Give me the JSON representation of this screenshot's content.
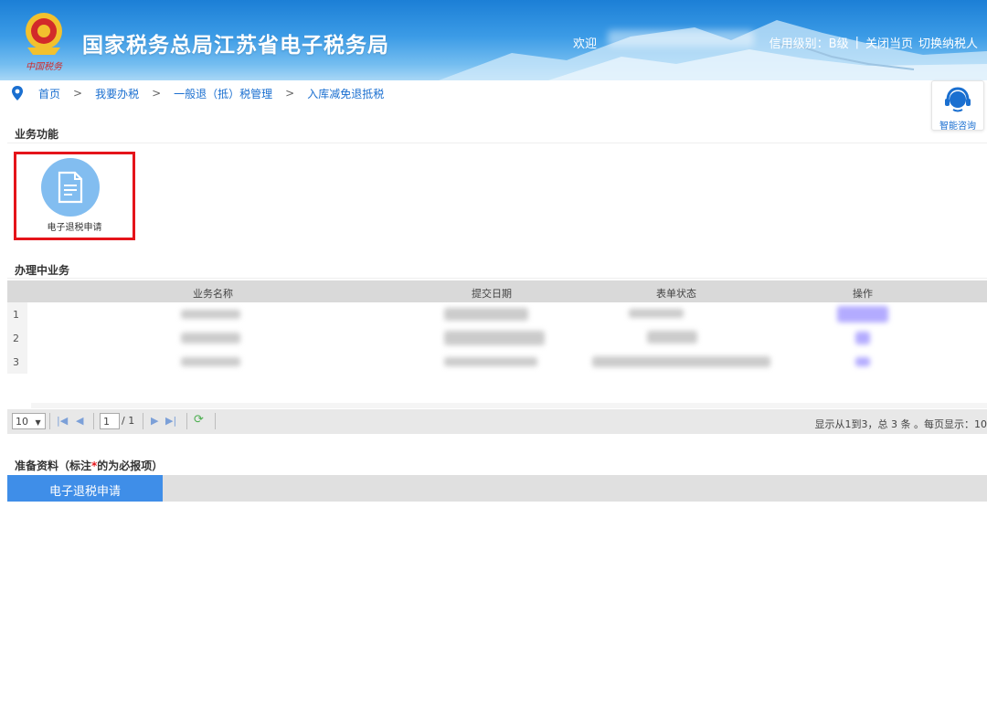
{
  "header": {
    "site_title": "国家税务总局江苏省电子税务局",
    "welcome": "欢迎",
    "credit_rating": "信用级别：B级",
    "separator": "|",
    "close_page": "关闭当页",
    "switch_taxpayer": "切换纳税人",
    "emblem_icon": "tax-emblem-icon"
  },
  "breadcrumb": {
    "items": [
      "首页",
      "我要办税",
      "一般退（抵）税管理",
      "入库减免退抵税"
    ],
    "separator": ">"
  },
  "consult": {
    "label": "智能咨询",
    "icon": "headset-icon"
  },
  "functions": {
    "title": "业务功能",
    "items": [
      {
        "label": "电子退税申请",
        "icon": "document-icon"
      }
    ]
  },
  "in_progress": {
    "title": "办理中业务",
    "columns": [
      "业务名称",
      "提交日期",
      "表单状态",
      "操作"
    ],
    "rows": [
      {
        "num": "1"
      },
      {
        "num": "2"
      },
      {
        "num": "3"
      }
    ]
  },
  "pager": {
    "page_size": "10",
    "page_size_arrow": "▼",
    "first": "|◀",
    "prev": "◀",
    "current_page": "1",
    "total_pages": "/ 1",
    "next": "▶",
    "last": "▶|",
    "refresh": "⟳",
    "summary": "显示从1到3，总 3 条 。每页显示：10"
  },
  "materials": {
    "title_prefix": "准备资料（标注",
    "required_mark": "*",
    "title_suffix": "的为必报项）",
    "tabs": [
      "电子退税申请"
    ]
  },
  "colors": {
    "accent": "#3f8ee8",
    "highlight_border": "#e5141a",
    "header_top": "#1c7fd6"
  }
}
